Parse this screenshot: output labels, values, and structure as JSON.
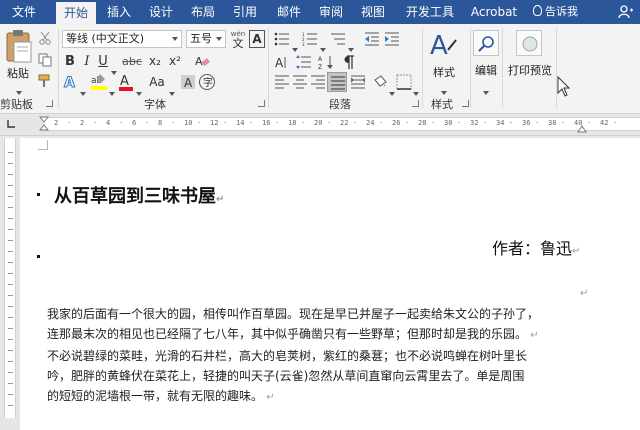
{
  "tabs": [
    "文件",
    "开始",
    "插入",
    "设计",
    "布局",
    "引用",
    "邮件",
    "审阅",
    "视图",
    "开发工具",
    "Acrobat"
  ],
  "active_tab": "开始",
  "tell_me": "告诉我",
  "clipboard": {
    "paste_label": "粘贴",
    "group_label": "剪贴板"
  },
  "font": {
    "font_name": "等线 (中文正文)",
    "font_size": "五号",
    "wen_label": "wén",
    "wen_char": "文",
    "a_box": "A",
    "bold": "B",
    "italic": "I",
    "underline": "U",
    "strike": "abc",
    "subscript": "x₂",
    "superscript": "x²",
    "aa_label": "Aa",
    "group_label": "字体"
  },
  "paragraph": {
    "group_label": "段落"
  },
  "styles": {
    "button_label": "样式",
    "group_label": "样式"
  },
  "editing": {
    "button_label": "编辑"
  },
  "print_preview": {
    "button_label": "打印预览"
  },
  "ruler": {
    "labels": [
      "2",
      "2",
      "4",
      "6",
      "8",
      "10",
      "12",
      "14",
      "16",
      "18",
      "20",
      "22",
      "24",
      "26",
      "28",
      "30",
      "32",
      "34",
      "36",
      "38",
      "40",
      "42"
    ]
  },
  "document": {
    "title": "从百草园到三味书屋",
    "author": "作者：鲁迅",
    "paragraph_lines": [
      "我家的后面有一个很大的园，相传叫作百草园。现在是早已并屋子一起卖给朱文公的子孙了，",
      "连那最末次的相见也已经隔了七八年，其中似乎确凿只有一些野草；但那时却是我的乐园。",
      "不必说碧绿的菜畦，光滑的石井栏，高大的皂荚树，紫红的桑葚；也不必说鸣蝉在树叶里长",
      "吟，肥胖的黄蜂伏在菜花上，轻捷的叫天子(云雀)忽然从草间直窜向云霄里去了。单是周围",
      "的短短的泥墙根一带，就有无限的趣味。"
    ]
  },
  "colors": {
    "tab_bar": "#2b579a",
    "ribbon_bg": "#f3f3f3",
    "highlight_yellow": "#ffff00",
    "font_red": "#e81123"
  }
}
